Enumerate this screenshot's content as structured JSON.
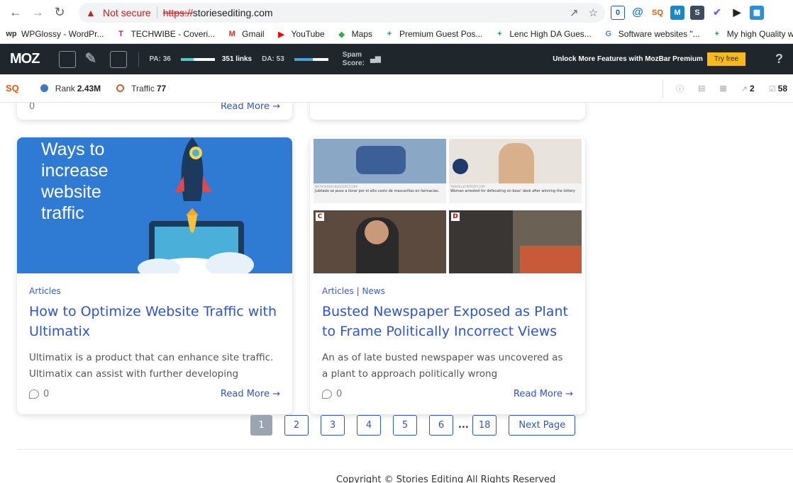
{
  "browser": {
    "not_secure": "Not secure",
    "url_scheme": "https://",
    "url_host": "storiesediting.com"
  },
  "bookmarks": [
    {
      "icon": "wp",
      "label": "WPGlossy - WordPr...",
      "color": "#333333"
    },
    {
      "icon": "T",
      "label": "TECHWIBE - Coveri...",
      "color": "#7b2fbf"
    },
    {
      "icon": "M",
      "label": "Gmail",
      "color": "#d93025"
    },
    {
      "icon": "▶",
      "label": "YouTube",
      "color": "#ff0000"
    },
    {
      "icon": "◆",
      "label": "Maps",
      "color": "#34a853"
    },
    {
      "icon": "+",
      "label": "Premium Guest Pos...",
      "color": "#0f9d58"
    },
    {
      "icon": "+",
      "label": "Lenc High DA Gues...",
      "color": "#0f9d58"
    },
    {
      "icon": "G",
      "label": "Software websites \"...",
      "color": "#4285f4"
    },
    {
      "icon": "+",
      "label": "My high Quality w",
      "color": "#0f9d58"
    }
  ],
  "mozbar": {
    "logo": "MOZ",
    "pa": "PA: 36",
    "links": "351 links",
    "da": "DA: 53",
    "spam": "Spam",
    "score": "Score:",
    "unlock": "Unlock More Features with MozBar Premium",
    "try_free": "Try free",
    "help": "?"
  },
  "seoquake": {
    "logo": "SQ",
    "rank_label": "Rank",
    "rank_value": "2.43M",
    "traffic_label": "Traffic",
    "traffic_value": "77",
    "links_in": "2",
    "links_out": "58"
  },
  "cards": [
    {
      "category": "Articles",
      "title": "How to Optimize Website Traffic with Ultimatix",
      "excerpt": "Ultimatix is a product that can enhance site traffic. Ultimatix can assist with further developing",
      "thumb_text": "Ways to increase website traffic",
      "comments": "0",
      "read_more": "Read More"
    },
    {
      "category": "Articles",
      "category2": "News",
      "title": "Busted Newspaper Exposed as Plant to Frame Politically Incorrect Views",
      "excerpt": "An as of late busted newspaper was uncovered as a plant to approach politically wrong",
      "comments": "0",
      "read_more": "Read More",
      "tile_captions": [
        "Jubilado se puso a llorar por el alto costo de mascarillas en farmacias.",
        "Woman arrested for defecating on boss' desk after winning the lottery"
      ],
      "tile_sources": [
        "NOTICIAS365.BLOGSPOT.COM",
        "THEVALLEYREPORT.COM"
      ],
      "tile_labels": [
        "C",
        "D"
      ]
    }
  ],
  "prev_cards": {
    "comments": "0",
    "read_more": "Read More"
  },
  "pagination": {
    "pages": [
      "1",
      "2",
      "3",
      "4",
      "5",
      "6"
    ],
    "ellipsis": "...",
    "last": "18",
    "next": "Next Page"
  },
  "footer": {
    "text": "Copyright © Stories Editing All Rights Reserved"
  }
}
